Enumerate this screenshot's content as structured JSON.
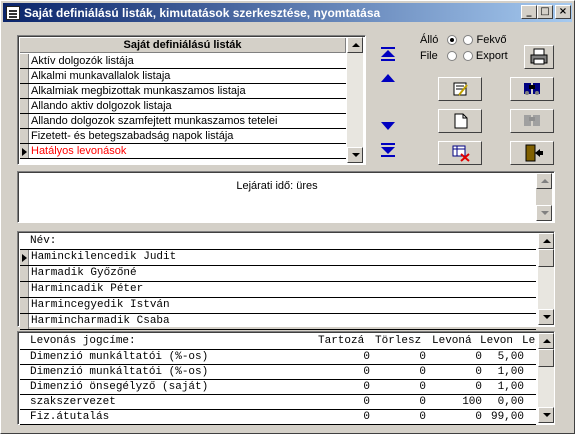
{
  "window": {
    "title": "Saját definiálású listák, kimutatások szerkesztése, nyomtatása",
    "minimize": "_",
    "maximize": "□",
    "close": "×"
  },
  "lists": {
    "header": "Saját definiálású listák",
    "items": [
      "Aktív dolgozók listája",
      "Alkalmi munkavallalok listaja",
      "Alkalmiak megbizottak munkaszamos listaja",
      "Allando aktiv dolgozok listaja",
      "Allando dolgozok szamfejtett munkaszamos tetelei",
      "Fizetett- és betegszabadság napok listája",
      "Hatályos levonások"
    ],
    "selected_index": 6,
    "selected_color": "#ff0000"
  },
  "orientation": {
    "label_left": "Álló",
    "label_right": "Fekvő",
    "selected": "Álló"
  },
  "output": {
    "label_left": "File",
    "label_right": "Export",
    "selected": "none"
  },
  "expiry_text": "Lejárati idő: üres",
  "names": {
    "header": "Név:",
    "rows": [
      "Haminckilencedik Judit",
      "Harmadik Győzőné",
      "Harmincadik Péter",
      "Harmincegyedik István",
      "Harmincharmadik Csaba"
    ]
  },
  "deductions": {
    "headers": [
      "Levonás jogcíme:",
      "Tartozá",
      "Törlesz",
      "Levoná",
      "Levon",
      "Lej"
    ],
    "rows": [
      [
        "Dimenzió munkáltatói (%-os)",
        "0",
        "0",
        "0",
        "5,00"
      ],
      [
        "Dimenzió munkáltatói (%-os)",
        "0",
        "0",
        "0",
        "1,00"
      ],
      [
        "Dimenzió önsegélyző (saját)",
        "0",
        "0",
        "0",
        "1,00"
      ],
      [
        "szakszervezet",
        "0",
        "0",
        "100",
        "0,00"
      ],
      [
        "Fiz.átutalás",
        "0",
        "0",
        "0",
        "99,00"
      ]
    ]
  },
  "icons": {
    "move_top": "double-up-arrow-icon",
    "move_up": "up-arrow-icon",
    "move_down": "down-arrow-icon",
    "move_bottom": "double-down-arrow-icon",
    "print": "printer-icon",
    "edit": "edit-list-icon",
    "find": "binoculars-icon",
    "new": "new-document-icon",
    "find_disabled": "binoculars-disabled-icon",
    "delete": "delete-grid-icon",
    "exit": "exit-door-icon"
  }
}
